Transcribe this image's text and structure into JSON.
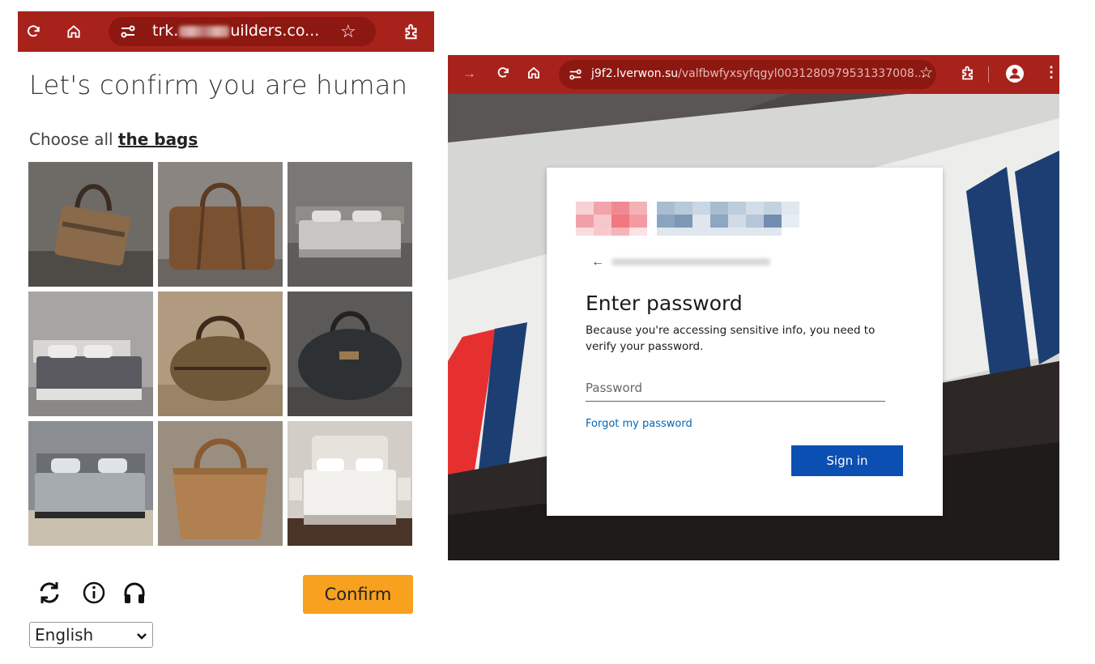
{
  "left_window": {
    "url": "trk.",
    "url_suffix": "uilders.co...",
    "icons": [
      "reload-icon",
      "home-icon",
      "site-info-icon",
      "star-icon",
      "extensions-icon"
    ]
  },
  "captcha": {
    "title": "Let's confirm you are human",
    "instruction_prefix": "Choose all ",
    "instruction_target": "the bags",
    "tiles": [
      {
        "subject": "bag"
      },
      {
        "subject": "bag"
      },
      {
        "subject": "bed"
      },
      {
        "subject": "bed"
      },
      {
        "subject": "bag"
      },
      {
        "subject": "bag"
      },
      {
        "subject": "bed"
      },
      {
        "subject": "bag"
      },
      {
        "subject": "bed"
      }
    ],
    "confirm_label": "Confirm",
    "language": "English",
    "bottom_icons": [
      "refresh-icon",
      "info-icon",
      "audio-headphones-icon"
    ]
  },
  "right_window": {
    "url_domain": "j9f2.lverwon.su",
    "url_path": "/valfbwfyxsyfqgyl0031280979531337008...",
    "login": {
      "title": "Enter password",
      "description": "Because you're accessing sensitive info, you need to verify your password.",
      "password_placeholder": "Password",
      "forgot_label": "Forgot my password",
      "signin_label": "Sign in"
    }
  },
  "colors": {
    "toolbar_red": "#a8221c",
    "confirm_orange": "#f7a11e",
    "signin_blue": "#0b4fb3",
    "link_blue": "#0067b8"
  }
}
